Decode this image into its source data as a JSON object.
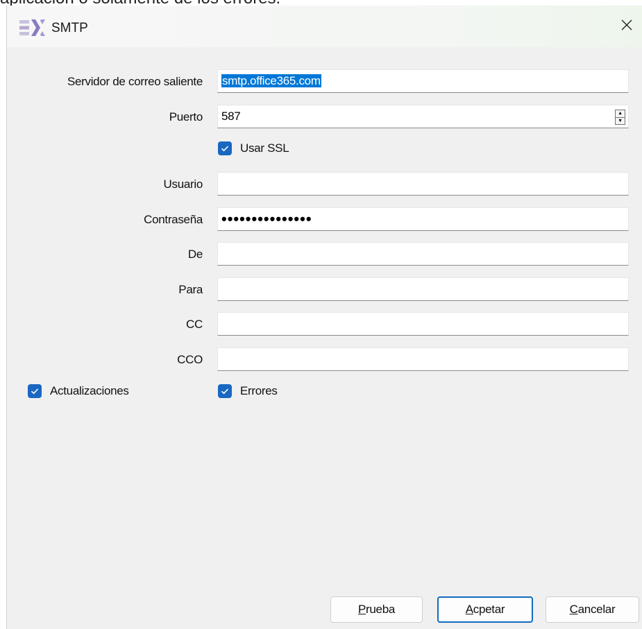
{
  "background": {
    "caption": "aplicación o solamente de los errores."
  },
  "window": {
    "title": "SMTP"
  },
  "form": {
    "server": {
      "label": "Servidor de correo saliente",
      "value": "smtp.office365.com"
    },
    "port": {
      "label": "Puerto",
      "value": "587"
    },
    "ssl": {
      "label": "Usar SSL",
      "checked": true
    },
    "user": {
      "label": "Usuario",
      "value": ""
    },
    "password": {
      "label": "Contraseña",
      "value": "•••••••••••••••"
    },
    "from": {
      "label": "De",
      "value": ""
    },
    "to": {
      "label": "Para",
      "value": ""
    },
    "cc": {
      "label": "CC",
      "value": ""
    },
    "bcc": {
      "label": "CCO",
      "value": ""
    },
    "updates": {
      "label": "Actualizaciones",
      "checked": true
    },
    "errors": {
      "label": "Errores",
      "checked": true
    }
  },
  "buttons": {
    "test": {
      "accel": "P",
      "rest": "rueba"
    },
    "accept": {
      "accel": "A",
      "rest": "cpetar"
    },
    "cancel": {
      "accel": "C",
      "rest": "ancelar"
    }
  },
  "colors": {
    "accent": "#1967c2",
    "selection": "#0078d7",
    "default_button_border": "#0f6cbd"
  }
}
